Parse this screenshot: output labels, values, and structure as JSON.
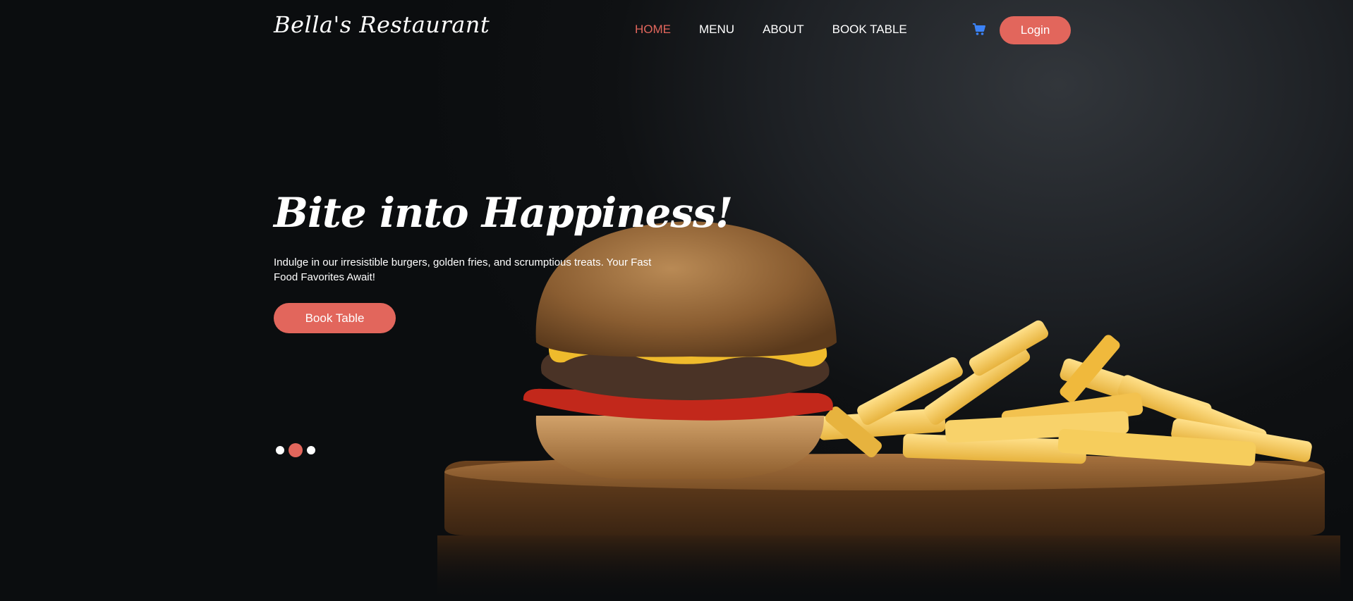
{
  "brand": {
    "name": "Bella's Restaurant"
  },
  "nav": {
    "items": [
      {
        "label": "HOME",
        "active": true
      },
      {
        "label": "MENU",
        "active": false
      },
      {
        "label": "ABOUT",
        "active": false
      },
      {
        "label": "BOOK TABLE",
        "active": false
      }
    ],
    "cart_icon": "shopping-cart-icon",
    "login_label": "Login"
  },
  "hero": {
    "title": "Bite into Happiness!",
    "text": "Indulge in our irresistible burgers, golden fries, and scrumptious treats. Your Fast Food Favorites Await!",
    "button_label": "Book Table",
    "slides": {
      "count": 3,
      "active_index": 1
    },
    "image": "burger-and-fries"
  },
  "colors": {
    "accent": "#e2665c",
    "active_nav": "#e2665c",
    "cart_icon": "#3b82f6",
    "text": "#ffffff",
    "background": "#0b0d0f"
  }
}
